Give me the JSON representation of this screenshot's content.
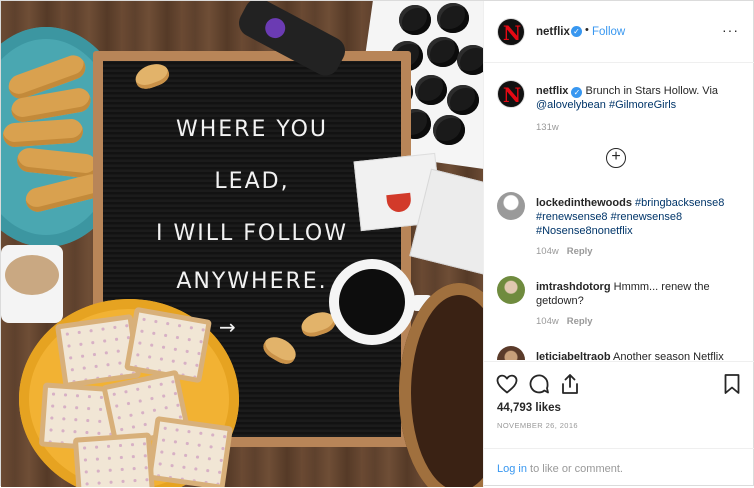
{
  "photo": {
    "board_lines": [
      "WHERE  YOU",
      "LEAD,",
      "I WILL FOLLOW",
      "ANYWHERE."
    ],
    "arrow": "→"
  },
  "header": {
    "username": "netflix",
    "verified_mark": "✓",
    "dot": "•",
    "follow_label": "Follow",
    "more_label": "···",
    "avatar_letter": "N"
  },
  "caption": {
    "username": "netflix",
    "text": "Brunch in Stars Hollow. Via",
    "mention": "@alovelybean",
    "hashtag": "#GilmoreGirls",
    "time": "131w"
  },
  "load_more_label": "+",
  "comments": [
    {
      "username": "lockedinthewoods",
      "text": "#bringbacksense8 #renewsense8 #renewsense8 #Nosense8nonetflix",
      "time": "104w",
      "reply": "Reply"
    },
    {
      "username": "imtrashdotorg",
      "text": "Hmmm... renew the getdown?",
      "time": "104w",
      "reply": "Reply"
    },
    {
      "username": "leticiabeltraob",
      "text": "Another season Netflix"
    }
  ],
  "actions": {
    "icons": [
      "heart-icon",
      "comment-icon",
      "share-icon",
      "bookmark-icon"
    ],
    "likes": "44,793 likes",
    "date": "NOVEMBER 26, 2016",
    "login_link": "Log in",
    "login_rest": "to like or comment."
  },
  "colors": {
    "accent": "#3897f0",
    "netflix_red": "#e50914",
    "text": "#262626",
    "muted": "#999999"
  }
}
